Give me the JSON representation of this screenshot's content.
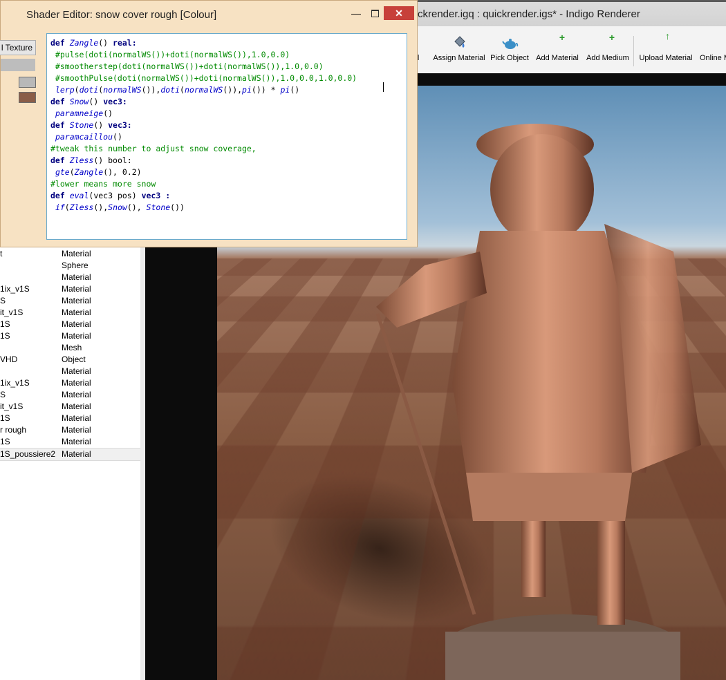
{
  "main_window": {
    "title": "ckrender.igq : quickrender.igs* - Indigo Renderer"
  },
  "toolbar": {
    "items": [
      {
        "label": "al",
        "icon": "material-edge-icon"
      },
      {
        "label": "Assign Material",
        "icon": "paint-bucket-icon"
      },
      {
        "label": "Pick Object",
        "icon": "teapot-icon"
      },
      {
        "label": "Add Material",
        "icon": "add-material-icon"
      },
      {
        "label": "Add Medium",
        "icon": "add-medium-icon"
      },
      {
        "label": "Upload Material",
        "icon": "upload-icon"
      },
      {
        "label": "Online M",
        "icon": "online-icon"
      }
    ]
  },
  "shader_editor": {
    "title": "Shader Editor: snow cover rough [Colour]",
    "texture_button": "l Texture",
    "swatch_colors": [
      "#b8b8b8",
      "#8a5d48"
    ],
    "code_lines": [
      [
        [
          "k",
          "def "
        ],
        [
          "fn",
          "Zangle"
        ],
        [
          "tx",
          "() "
        ],
        [
          "k",
          "real:"
        ]
      ],
      [
        [
          "cm",
          " #pulse(doti(normalWS())+doti(normalWS()),1.0,0.0)"
        ]
      ],
      [
        [
          "cm",
          " #smootherstep(doti(normalWS())+doti(normalWS()),1.0,0.0)"
        ]
      ],
      [
        [
          "cm",
          " #smoothPulse(doti(normalWS())+doti(normalWS()),1.0,0.0,1.0,0.0)"
        ]
      ],
      [
        [
          "tx",
          " "
        ],
        [
          "fn",
          "lerp"
        ],
        [
          "tx",
          "("
        ],
        [
          "fn",
          "doti"
        ],
        [
          "tx",
          "("
        ],
        [
          "fn",
          "normalWS"
        ],
        [
          "tx",
          "()),"
        ],
        [
          "fn",
          "doti"
        ],
        [
          "tx",
          "("
        ],
        [
          "fn",
          "normalWS"
        ],
        [
          "tx",
          "()),"
        ],
        [
          "fn",
          "pi"
        ],
        [
          "tx",
          "()) * "
        ],
        [
          "fn",
          "pi"
        ],
        [
          "tx",
          "()"
        ]
      ],
      [
        [
          "k",
          "def "
        ],
        [
          "fn",
          "Snow"
        ],
        [
          "tx",
          "() "
        ],
        [
          "k",
          "vec3:"
        ]
      ],
      [
        [
          "tx",
          " "
        ],
        [
          "fn",
          "paramneige"
        ],
        [
          "tx",
          "()"
        ]
      ],
      [
        [
          "k",
          "def "
        ],
        [
          "fn",
          "Stone"
        ],
        [
          "tx",
          "() "
        ],
        [
          "k",
          "vec3:"
        ]
      ],
      [
        [
          "tx",
          " "
        ],
        [
          "fn",
          "paramcaillou"
        ],
        [
          "tx",
          "()"
        ]
      ],
      [
        [
          "cm",
          "#tweak this number to adjust snow coverage,"
        ]
      ],
      [
        [
          "k",
          "def "
        ],
        [
          "fn",
          "Zless"
        ],
        [
          "tx",
          "() bool:"
        ]
      ],
      [
        [
          "tx",
          " "
        ],
        [
          "fn",
          "gte"
        ],
        [
          "tx",
          "("
        ],
        [
          "fn",
          "Zangle"
        ],
        [
          "tx",
          "(), 0.2)"
        ]
      ],
      [
        [
          "cm",
          "#lower means more snow"
        ]
      ],
      [
        [
          "k",
          "def "
        ],
        [
          "fn",
          "eval"
        ],
        [
          "tx",
          "(vec3 pos) "
        ],
        [
          "k",
          "vec3 :"
        ]
      ],
      [
        [
          "tx",
          " "
        ],
        [
          "fn",
          "if"
        ],
        [
          "tx",
          "("
        ],
        [
          "fn",
          "Zless"
        ],
        [
          "tx",
          "(),"
        ],
        [
          "fn",
          "Snow"
        ],
        [
          "tx",
          "(), "
        ],
        [
          "fn",
          "Stone"
        ],
        [
          "tx",
          "())"
        ]
      ]
    ]
  },
  "scene_list": {
    "rows": [
      {
        "name": "t",
        "type": "Material"
      },
      {
        "name": "",
        "type": "Sphere"
      },
      {
        "name": "",
        "type": "Material"
      },
      {
        "name": "1ix_v1S",
        "type": "Material"
      },
      {
        "name": "S",
        "type": "Material"
      },
      {
        "name": "it_v1S",
        "type": "Material"
      },
      {
        "name": "1S",
        "type": "Material"
      },
      {
        "name": "1S",
        "type": "Material"
      },
      {
        "name": "",
        "type": "Mesh"
      },
      {
        "name": "VHD",
        "type": "Object"
      },
      {
        "name": "",
        "type": "Material"
      },
      {
        "name": "1ix_v1S",
        "type": "Material"
      },
      {
        "name": "S",
        "type": "Material"
      },
      {
        "name": "it_v1S",
        "type": "Material"
      },
      {
        "name": "1S",
        "type": "Material"
      },
      {
        "name": "r rough",
        "type": "Material"
      },
      {
        "name": "1S",
        "type": "Material"
      },
      {
        "name": "1S_poussiere2",
        "type": "Material",
        "selected": true
      }
    ]
  }
}
